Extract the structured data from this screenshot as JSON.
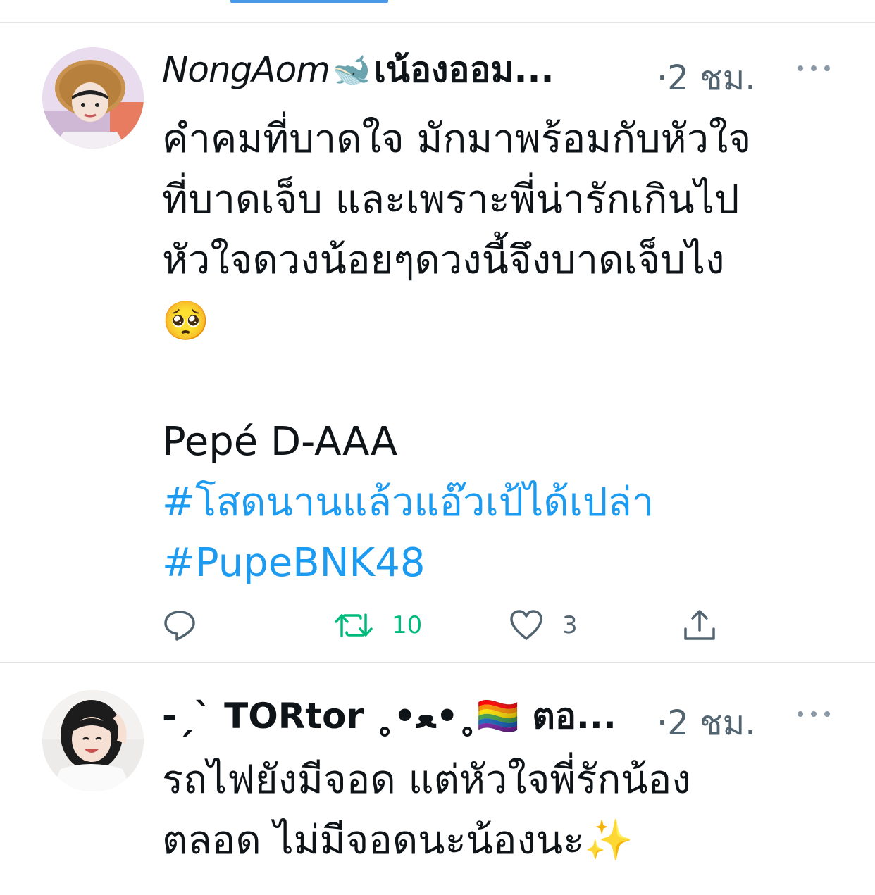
{
  "tweets": [
    {
      "display_name_latin": "NongAom",
      "display_name_emoji": "🐋",
      "display_name_thai": "เน้องออม...",
      "time": "·2 ชม.",
      "body_lines": [
        "คำคมที่บาดใจ มักมาพร้อมกับหัวใจ",
        "ที่บาดเจ็บ และเพราะพี่น่ารักเกินไป",
        "หัวใจดวงน้อยๆดวงนี้จึงบาดเจ็บไง"
      ],
      "body_emoji": "🥺",
      "signature": "Pepé D-AAA",
      "hashtags": [
        "#โสดนานแล้วแอ๊วเป้ได้เปล่า",
        "#PupeBNK48"
      ],
      "actions": {
        "reply_count": "",
        "retweet_count": "10",
        "like_count": "3"
      }
    },
    {
      "display_name": "-ˏˋ TORtor ˳•ﻌ•˳🏳️‍🌈 ตอ...",
      "time": "·2 ชม.",
      "body_lines": [
        "รถไฟยังมีจอด แต่หัวใจพี่รักน้อง",
        "ตลอด ไม่มีจอดนะน้องนะ✨"
      ]
    }
  ],
  "colors": {
    "hashtag": "#1d9bf0",
    "retweet_green": "#00ba7c",
    "secondary_text": "#536471",
    "tab_indicator": "#4a99e9"
  },
  "icons": [
    "more-icon",
    "reply-icon",
    "retweet-icon",
    "like-icon",
    "share-icon"
  ]
}
